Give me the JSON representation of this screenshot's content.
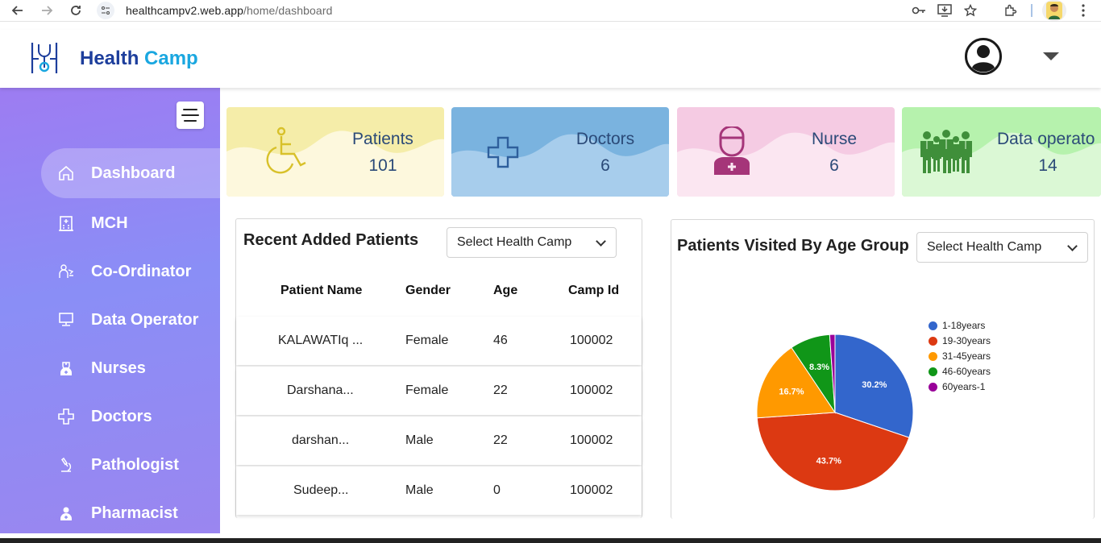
{
  "browser": {
    "url_host": "healthcampv2.web.app",
    "url_path": "/home/dashboard"
  },
  "header": {
    "brand_part1": "Health",
    "brand_part2": "Camp"
  },
  "sidebar": {
    "items": [
      {
        "label": "Dashboard",
        "icon": "home-icon",
        "active": true
      },
      {
        "label": "MCH",
        "icon": "hospital-icon"
      },
      {
        "label": "Co-Ordinator",
        "icon": "coordinator-icon"
      },
      {
        "label": "Data Operator",
        "icon": "monitor-icon"
      },
      {
        "label": "Nurses",
        "icon": "nurse-icon"
      },
      {
        "label": "Doctors",
        "icon": "medical-cross-icon"
      },
      {
        "label": "Pathologist",
        "icon": "microscope-icon"
      },
      {
        "label": "Pharmacist",
        "icon": "pharmacist-icon"
      }
    ]
  },
  "stats": [
    {
      "title": "Patients",
      "count": "101",
      "icon": "wheelchair-icon",
      "bg": "#f5eda9",
      "wave": "#fdf8dd",
      "icon_color": "#d8c12a"
    },
    {
      "title": "Doctors",
      "count": "6",
      "icon": "medical-cross-icon",
      "bg": "#7ab3df",
      "wave": "#a7cdec",
      "icon_color": "#2e5f9c"
    },
    {
      "title": "Nurse",
      "count": "6",
      "icon": "nurse-icon",
      "bg": "#f5cbe3",
      "wave": "#fbe6f1",
      "icon_color": "#a53579"
    },
    {
      "title": "Data operato",
      "count": "14",
      "icon": "team-icon",
      "bg": "#b6f2ad",
      "wave": "#dbf8d5",
      "icon_color": "#3f8f3a"
    }
  ],
  "patients_panel": {
    "title": "Recent Added Patients",
    "select_label": "Select Health Camp",
    "columns": [
      "Patient Name",
      "Gender",
      "Age",
      "Camp Id"
    ],
    "rows": [
      {
        "name": "KALAWATIq ...",
        "gender": "Female",
        "age": "46",
        "camp_id": "100002"
      },
      {
        "name": "Darshana...",
        "gender": "Female",
        "age": "22",
        "camp_id": "100002"
      },
      {
        "name": "darshan...",
        "gender": "Male",
        "age": "22",
        "camp_id": "100002"
      },
      {
        "name": "Sudeep...",
        "gender": "Male",
        "age": "0",
        "camp_id": "100002"
      }
    ]
  },
  "age_panel": {
    "title": "Patients Visited By Age Group",
    "select_label": "Select Health Camp"
  },
  "chart_data": {
    "type": "pie",
    "title": "Patients Visited By Age Group",
    "categories": [
      "1-18years",
      "19-30years",
      "31-45years",
      "46-60years",
      "60years-1"
    ],
    "values": [
      30.2,
      43.7,
      16.7,
      8.3,
      1.1
    ],
    "labels": [
      "30.2%",
      "43.7%",
      "16.7%",
      "8.3%",
      ""
    ],
    "colors": [
      "#3366cc",
      "#dc3912",
      "#ff9900",
      "#109618",
      "#990099"
    ],
    "legend": "right"
  }
}
